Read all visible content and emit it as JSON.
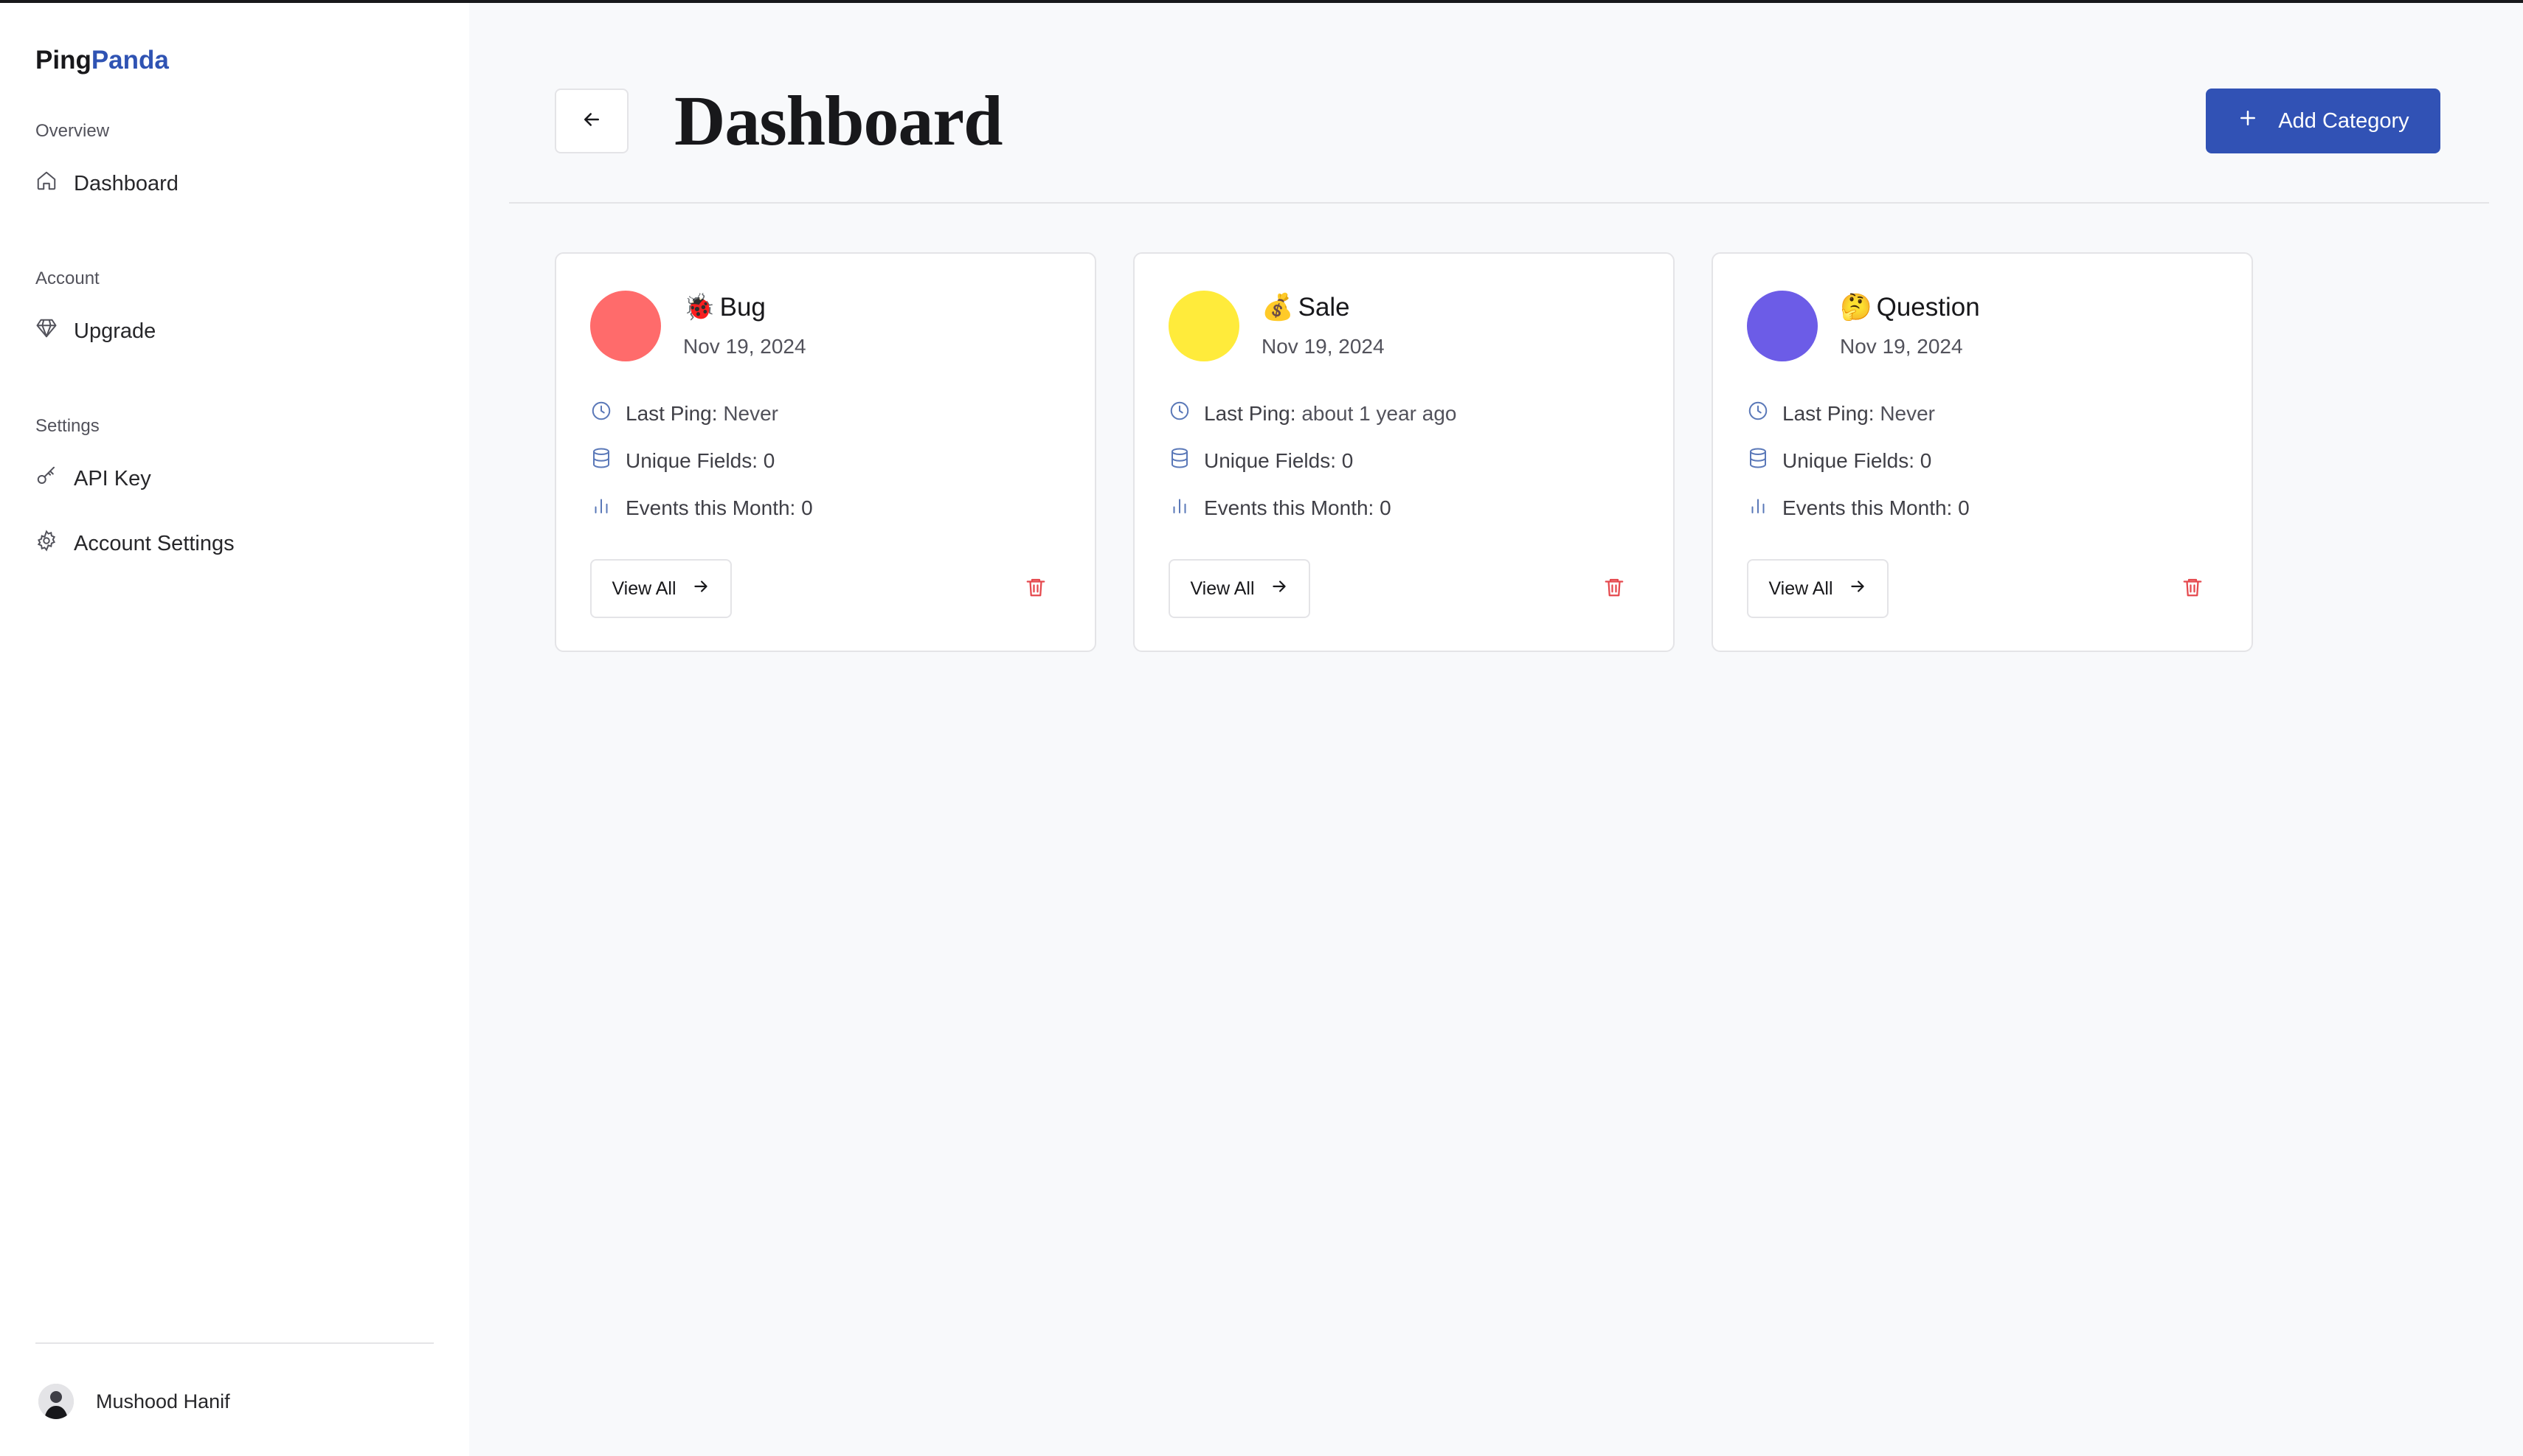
{
  "brand": {
    "part1": "Ping",
    "part2": "Panda",
    "accent_color": "#2f53b3"
  },
  "sidebar": {
    "sections": [
      {
        "title": "Overview",
        "items": [
          {
            "label": "Dashboard",
            "icon": "home-icon"
          }
        ]
      },
      {
        "title": "Account",
        "items": [
          {
            "label": "Upgrade",
            "icon": "gem-icon"
          }
        ]
      },
      {
        "title": "Settings",
        "items": [
          {
            "label": "API Key",
            "icon": "key-icon"
          },
          {
            "label": "Account Settings",
            "icon": "gear-icon"
          }
        ]
      }
    ],
    "user": {
      "name": "Mushood Hanif"
    }
  },
  "header": {
    "title": "Dashboard",
    "back_icon": "arrow-left-icon",
    "add_label": "Add Category",
    "add_color": "#3152b5"
  },
  "cards": [
    {
      "emoji": "🐞",
      "name": "Bug",
      "color": "#ff6b6b",
      "date": "Nov 19, 2024",
      "last_ping_label": "Last Ping:",
      "last_ping": "Never",
      "unique_label": "Unique Fields:",
      "unique": "0",
      "events_label": "Events this Month:",
      "events": "0",
      "view_label": "View All"
    },
    {
      "emoji": "💰",
      "name": "Sale",
      "color": "#ffeb3b",
      "date": "Nov 19, 2024",
      "last_ping_label": "Last Ping:",
      "last_ping": "about 1 year ago",
      "unique_label": "Unique Fields:",
      "unique": "0",
      "events_label": "Events this Month:",
      "events": "0",
      "view_label": "View All"
    },
    {
      "emoji": "🤔",
      "name": "Question",
      "color": "#6c5ce7",
      "date": "Nov 19, 2024",
      "last_ping_label": "Last Ping:",
      "last_ping": "Never",
      "unique_label": "Unique Fields:",
      "unique": "0",
      "events_label": "Events this Month:",
      "events": "0",
      "view_label": "View All"
    }
  ]
}
